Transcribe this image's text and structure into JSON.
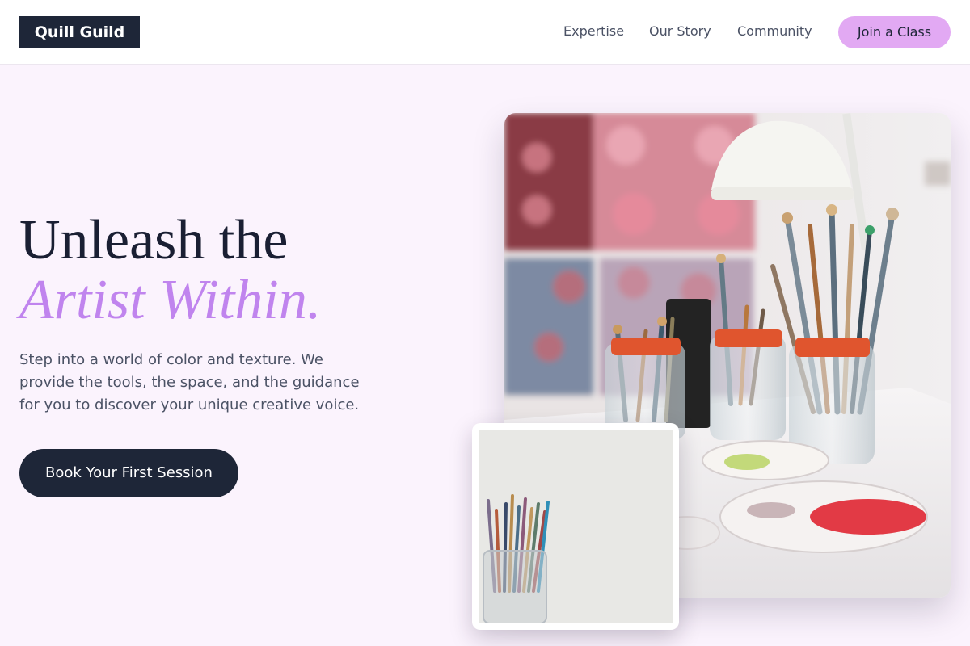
{
  "header": {
    "logo": "Quill Guild",
    "nav": [
      "Expertise",
      "Our Story",
      "Community"
    ],
    "cta": "Join a Class"
  },
  "hero": {
    "title_line1": "Unleash the",
    "title_line2": "Artist Within.",
    "description": "Step into a world of color and texture. We provide the tools, the space, and the guidance for you to discover your unique creative voice.",
    "button": "Book Your First Session"
  },
  "colors": {
    "background": "#fbf3fd",
    "dark": "#1e2638",
    "accent": "#c084ee",
    "button_pink": "#e2a9f3"
  }
}
